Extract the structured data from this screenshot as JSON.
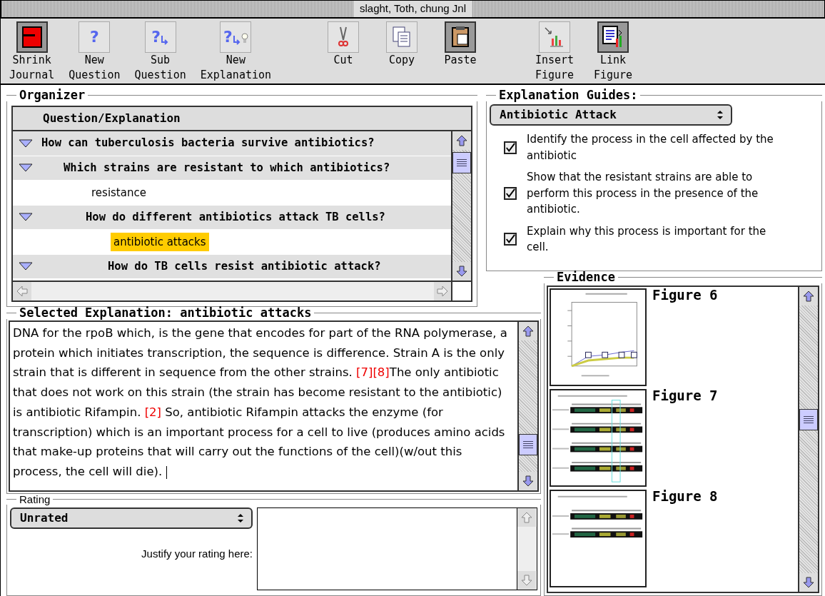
{
  "window": {
    "title": "slaght, Toth, chung Jnl"
  },
  "toolbar_groups": [
    {
      "buttons": [
        {
          "kind": "book",
          "label": [
            "Shrink",
            "Journal"
          ],
          "highlighted": true
        },
        {
          "kind": "question",
          "glyph": "?",
          "label": [
            "New",
            "Question"
          ],
          "highlighted": false
        },
        {
          "kind": "subquestion",
          "glyph": "?",
          "label": [
            "Sub",
            "Question"
          ],
          "highlighted": false
        },
        {
          "kind": "explanation",
          "glyph": "?",
          "label": [
            "New",
            "Explanation"
          ],
          "highlighted": false
        }
      ]
    },
    {
      "buttons": [
        {
          "kind": "cut",
          "label": [
            "Cut"
          ],
          "highlighted": false
        },
        {
          "kind": "copy",
          "label": [
            "Copy"
          ],
          "highlighted": false
        },
        {
          "kind": "paste",
          "label": [
            "Paste"
          ],
          "highlighted": true
        }
      ]
    },
    {
      "buttons": [
        {
          "kind": "chart",
          "label": [
            "Insert",
            "Figure"
          ],
          "highlighted": false
        },
        {
          "kind": "link",
          "label": [
            "Link",
            "Figure"
          ],
          "highlighted": true
        }
      ]
    }
  ],
  "organizer": {
    "title": "Organizer",
    "column": "Question/Explanation",
    "items": [
      {
        "kind": "question",
        "text": "How can tuberculosis bacteria survive antibiotics?",
        "expanded": true,
        "selected": false,
        "children": [
          {
            "kind": "question",
            "text": "Which strains are resistant to which antibiotics?",
            "expanded": true,
            "selected": false,
            "children": [
              {
                "kind": "explanation",
                "text": "resistance",
                "selected": false
              },
              {
                "kind": "question",
                "text": "How do different antibiotics attack TB cells?",
                "expanded": true,
                "selected": false,
                "children": [
                  {
                    "kind": "explanation",
                    "text": "antibiotic attacks",
                    "selected": true
                  },
                  {
                    "kind": "question",
                    "text": "How do TB cells resist antibiotic attack?",
                    "expanded": true,
                    "selected": false
                  }
                ]
              }
            ]
          }
        ]
      }
    ]
  },
  "guides": {
    "title": "Explanation Guides:",
    "dropdown": "Antibiotic Attack",
    "items": [
      {
        "text": "Identify the process in the cell affected by the antibiotic",
        "checked": true
      },
      {
        "text": "Show that the resistant strains are able to perform this process in the presence of the antibiotic.",
        "checked": true
      },
      {
        "text": "Explain why this process is important for the cell.",
        "checked": true
      }
    ]
  },
  "explanation": {
    "title": "Selected Explanation: antibiotic attacks",
    "segments": [
      {
        "kind": "text",
        "text": "DNA for the rpoB which, is the gene that encodes for part of the RNA polymerase, a protein which initiates transcription, the sequence is difference. Strain A is the only strain that is different in sequence from the other strains.  "
      },
      {
        "kind": "ref",
        "text": "[7]"
      },
      {
        "kind": "ref",
        "text": "[8]"
      },
      {
        "kind": "text",
        "text": "The only antibiotic that does not work on this strain (the strain has become resistant to the antibiotic) is antibiotic Rifampin. "
      },
      {
        "kind": "ref",
        "text": "[2]"
      },
      {
        "kind": "text",
        "text": " So, antibiotic Rifampin attacks the enzyme (for transcription) which is an important  process for a cell to live (produces amino acids that make-up proteins that will carry out the functions of the cell)(w/out this process, the cell will die)."
      }
    ]
  },
  "rating": {
    "title": "Rating",
    "dropdown": "Unrated",
    "prompt": "Justify your rating here:"
  },
  "evidence": {
    "title": "Evidence",
    "figures": [
      {
        "label": "Figure 6",
        "kind": "chart",
        "highlight": false
      },
      {
        "label": "Figure 7",
        "kind": "alignment",
        "highlight": true,
        "sequences": [
          {
            "kind": "strain"
          },
          {
            "kind": "strain"
          },
          {
            "kind": "strain"
          },
          {
            "kind": "strain"
          }
        ]
      },
      {
        "label": "Figure 8",
        "kind": "alignment",
        "highlight": false,
        "sequences": [
          {
            "kind": "strain"
          },
          {
            "kind": "strain"
          }
        ]
      }
    ]
  }
}
